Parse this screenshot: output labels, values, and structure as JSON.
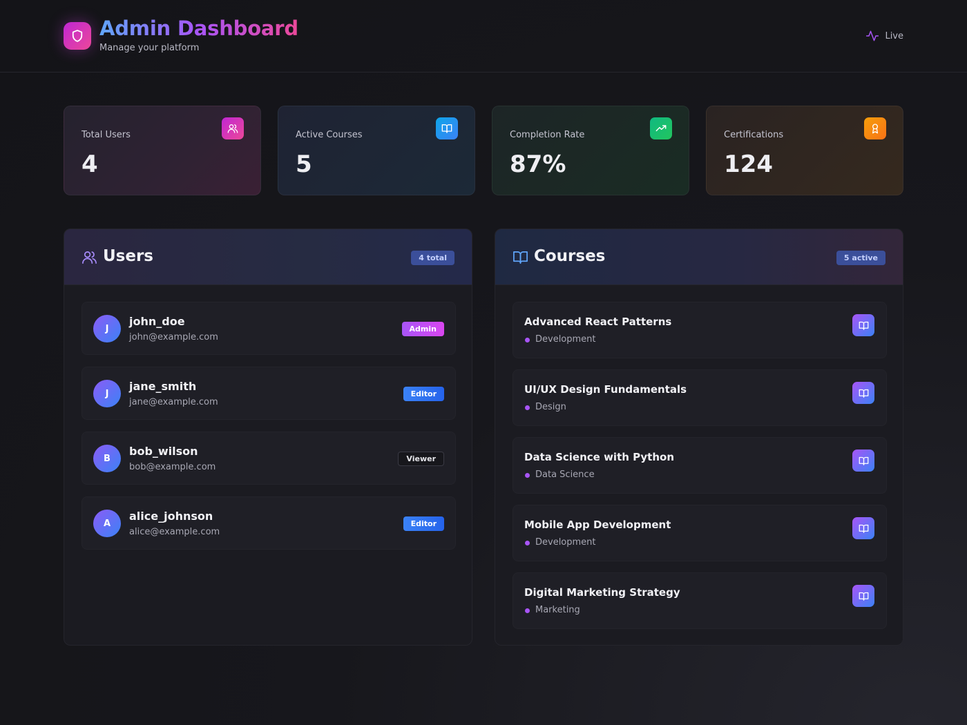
{
  "header": {
    "title": "Admin Dashboard",
    "subtitle": "Manage your platform",
    "status": "Live",
    "logo_icon": "shield-icon"
  },
  "stats": [
    {
      "label": "Total Users",
      "value": "4",
      "icon": "users-icon",
      "color": "#d946ef"
    },
    {
      "label": "Active Courses",
      "value": "5",
      "icon": "book-open-icon",
      "color": "#0ea5e9"
    },
    {
      "label": "Completion Rate",
      "value": "87%",
      "icon": "trending-up-icon",
      "color": "#22c55e"
    },
    {
      "label": "Certifications",
      "value": "124",
      "icon": "award-icon",
      "color": "#f59e0b"
    }
  ],
  "users_panel": {
    "title": "Users",
    "badge": "4 total",
    "icon": "users-icon",
    "items": [
      {
        "initial": "J",
        "username": "john_doe",
        "email": "john@example.com",
        "role": "Admin"
      },
      {
        "initial": "J",
        "username": "jane_smith",
        "email": "jane@example.com",
        "role": "Editor"
      },
      {
        "initial": "B",
        "username": "bob_wilson",
        "email": "bob@example.com",
        "role": "Viewer"
      },
      {
        "initial": "A",
        "username": "alice_johnson",
        "email": "alice@example.com",
        "role": "Editor"
      }
    ]
  },
  "courses_panel": {
    "title": "Courses",
    "badge": "5 active",
    "icon": "book-open-icon",
    "items": [
      {
        "title": "Advanced React Patterns",
        "category": "Development"
      },
      {
        "title": "UI/UX Design Fundamentals",
        "category": "Design"
      },
      {
        "title": "Data Science with Python",
        "category": "Data Science"
      },
      {
        "title": "Mobile App Development",
        "category": "Development"
      },
      {
        "title": "Digital Marketing Strategy",
        "category": "Marketing"
      }
    ]
  }
}
